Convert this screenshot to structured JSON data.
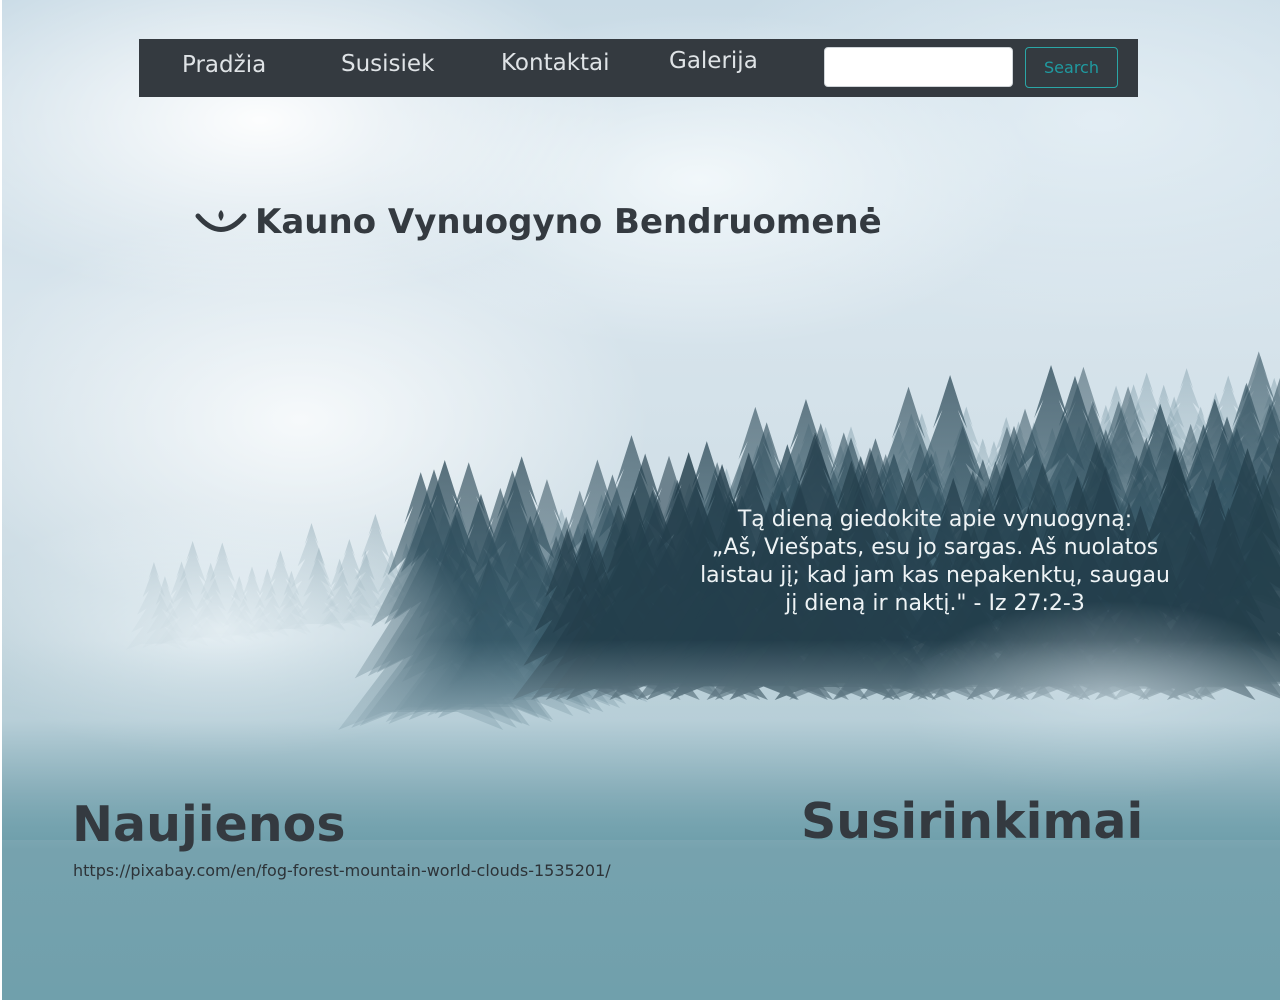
{
  "navbar": {
    "links": [
      {
        "label": "Pradžia"
      },
      {
        "label": "Susisiek"
      },
      {
        "label": "Kontaktai"
      },
      {
        "label": "Galerija"
      }
    ],
    "search": {
      "placeholder": "",
      "value": "",
      "button_label": "Search"
    }
  },
  "brand": {
    "logo_icon": "smile-vine-icon",
    "title": "Kauno Vynuogyno Bendruomenė"
  },
  "hero": {
    "quote_lines": [
      "Tą dieną giedokite apie vynuogyną:",
      "„Aš, Viešpats, esu jo sargas. Aš nuolatos",
      "laistau jį; kad jam kas nepakenktų, saugau",
      "jį dieną ir naktį.\" - Iz 27:2-3"
    ]
  },
  "sections": {
    "news_title": "Naujienos",
    "meetings_title": "Susirinkimai",
    "image_credit": "https://pixabay.com/en/fog-forest-mountain-world-clouds-1535201/"
  },
  "colors": {
    "navbar_bg": "#343a40",
    "nav_text": "#dfe3e6",
    "search_button_accent": "#1f9aa0",
    "heading_text": "#343a40",
    "quote_text": "#eef3f5",
    "page_bottom_bg": "#6f9eab"
  }
}
